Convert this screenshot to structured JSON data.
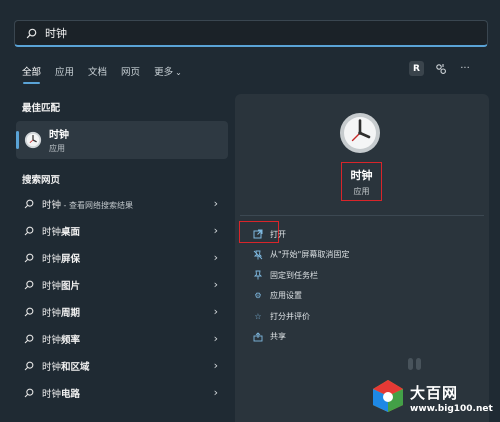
{
  "search": {
    "query": "时钟"
  },
  "tabs": [
    {
      "label": "全部"
    },
    {
      "label": "应用"
    },
    {
      "label": "文档"
    },
    {
      "label": "网页"
    },
    {
      "label": "更多"
    }
  ],
  "header_right": {
    "avatar_letter": "R"
  },
  "best_match": {
    "title": "最佳匹配",
    "name": "时钟",
    "type": "应用"
  },
  "web_search": {
    "title": "搜索网页",
    "items": [
      {
        "query": "时钟",
        "suffix": " - 查看网络搜索结果"
      },
      {
        "query": "时钟",
        "bold": "桌面"
      },
      {
        "query": "时钟",
        "bold": "屏保"
      },
      {
        "query": "时钟",
        "bold": "图片"
      },
      {
        "query": "时钟",
        "bold": "周期"
      },
      {
        "query": "时钟",
        "bold": "频率"
      },
      {
        "query": "时钟",
        "bold": "和区域"
      },
      {
        "query": "时钟",
        "bold": "电路"
      }
    ]
  },
  "detail": {
    "name": "时钟",
    "type": "应用",
    "actions": [
      {
        "label": "打开",
        "icon": "open-external-icon"
      },
      {
        "label": "从\"开始\"屏幕取消固定",
        "icon": "unpin-icon"
      },
      {
        "label": "固定到任务栏",
        "icon": "pin-icon"
      },
      {
        "label": "应用设置",
        "icon": "gear-icon"
      },
      {
        "label": "打分并评价",
        "icon": "star-icon"
      },
      {
        "label": "共享",
        "icon": "share-icon"
      }
    ]
  },
  "watermark": {
    "title": "大百网",
    "url": "www.big100.net"
  },
  "colors": {
    "accent": "#5aa3d6",
    "highlight_box": "#d9252a"
  }
}
